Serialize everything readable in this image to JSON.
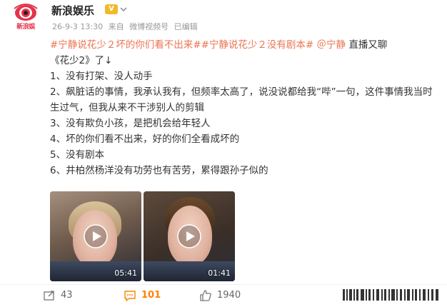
{
  "header": {
    "author": "新浪娱乐",
    "avatar_text": "新浪娱",
    "vip_badge": "V",
    "meta": {
      "date": "26-9-3 13:30",
      "source_prefix": "来自",
      "source": "微博视频号",
      "edited": "已编辑"
    }
  },
  "post": {
    "tag1": "#宁静说花少２坏的你们看不出来#",
    "tag2": "#宁静说花少２没有剧本#",
    "mention": "＠宁静",
    "intro_tail": "直播又聊",
    "intro_line2": "《花少2》了↓",
    "items": [
      "1、没有打架、没人动手",
      "2、飙脏话的事情，我承认我有，但频率太高了，说没说都给我“哔”一句，这件事情我当时生过气，但我从来不干涉别人的剪辑",
      "3、没有欺负小孩，是把机会给年轻人",
      "4、坏的你们看不出来，好的你们全看成坏的",
      "5、没有剧本",
      "6、井柏然杨洋没有功劳也有苦劳，累得跟孙子似的"
    ]
  },
  "videos": [
    {
      "duration": "05:41"
    },
    {
      "duration": "01:41"
    }
  ],
  "actions": {
    "repost_count": "43",
    "comment_count": "101",
    "like_count": "1940"
  },
  "colors": {
    "tag": "#eb7350",
    "comment_active": "#ff8200",
    "vip": "#f3b92b",
    "avatar_red": "#e5334a"
  }
}
